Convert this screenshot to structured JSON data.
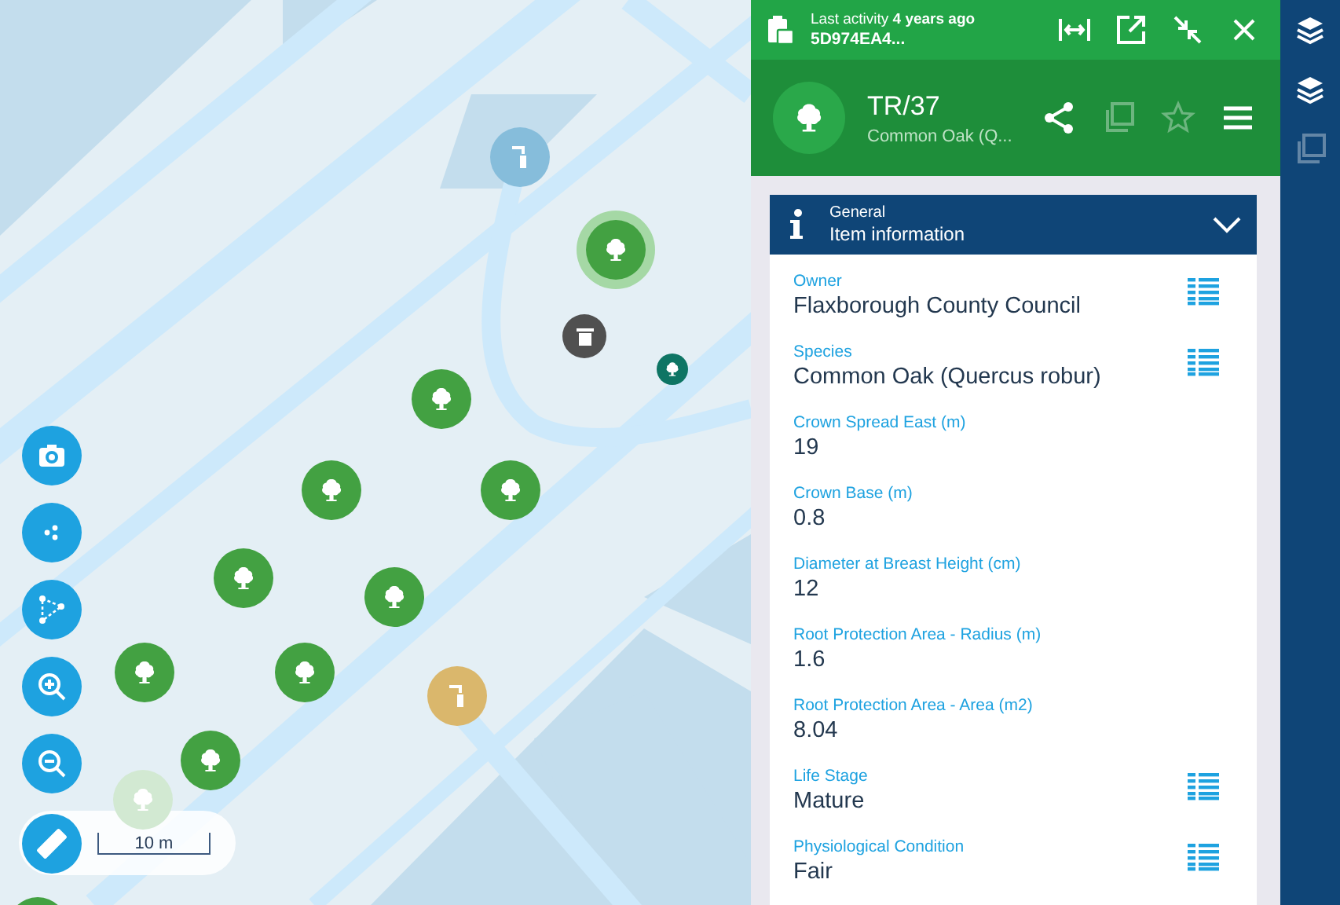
{
  "map": {
    "tools": [
      {
        "kind": "camera"
      },
      {
        "kind": "points"
      },
      {
        "kind": "polygon"
      },
      {
        "kind": "zoom-in"
      },
      {
        "kind": "zoom-out"
      }
    ],
    "scale": {
      "label": "10 m"
    },
    "markers": [
      {
        "kind": "lamp",
        "color": "#86bddb",
        "selected": false
      },
      {
        "kind": "tree",
        "color": "#43a142",
        "selected": true
      },
      {
        "kind": "bin",
        "color": "#505050",
        "selected": false
      },
      {
        "kind": "tree",
        "color": "#0e7564",
        "selected": false
      },
      {
        "kind": "tree",
        "color": "#43a142",
        "selected": false
      },
      {
        "kind": "tree",
        "color": "#43a142",
        "selected": false
      },
      {
        "kind": "tree",
        "color": "#43a142",
        "selected": false
      },
      {
        "kind": "tree",
        "color": "#43a142",
        "selected": false
      },
      {
        "kind": "tree",
        "color": "#43a142",
        "selected": false
      },
      {
        "kind": "tree",
        "color": "#43a142",
        "selected": false
      },
      {
        "kind": "tree",
        "color": "#43a142",
        "selected": false
      },
      {
        "kind": "lamp",
        "color": "#dab76c",
        "selected": false
      },
      {
        "kind": "tree",
        "color": "#43a142",
        "selected": false
      },
      {
        "kind": "tree",
        "color": "#d2e9d2",
        "selected": false
      },
      {
        "kind": "tree",
        "color": "#43a142",
        "selected": false
      }
    ]
  },
  "panel": {
    "activity": "Last activity **4 years ago**",
    "id": "5D974EA4...",
    "title": "TR/37",
    "subtitle": "Common Oak (Q...",
    "actions": [
      {
        "kind": "share",
        "disabled": false
      },
      {
        "kind": "copy",
        "disabled": true
      },
      {
        "kind": "star",
        "disabled": true
      },
      {
        "kind": "menu",
        "disabled": false
      }
    ],
    "section": {
      "overline": "General",
      "title": "Item information",
      "expanded": true
    },
    "fields": [
      {
        "label": "Owner",
        "value": "Flaxborough County Council",
        "lookup": true
      },
      {
        "label": "Species",
        "value": "Common Oak (Quercus robur)",
        "lookup": true
      },
      {
        "label": "Crown Spread East (m)",
        "value": "19",
        "lookup": false
      },
      {
        "label": "Crown Base (m)",
        "value": "0.8",
        "lookup": false
      },
      {
        "label": "Diameter at Breast Height (cm)",
        "value": "12",
        "lookup": false
      },
      {
        "label": "Root Protection Area - Radius (m)",
        "value": "1.6",
        "lookup": false
      },
      {
        "label": "Root Protection Area - Area (m2)",
        "value": "8.04",
        "lookup": false
      },
      {
        "label": "Life Stage",
        "value": "Mature",
        "lookup": true
      },
      {
        "label": "Physiological Condition",
        "value": "Fair",
        "lookup": true
      }
    ]
  },
  "rail": [
    {
      "kind": "layers",
      "disabled": false
    },
    {
      "kind": "layers",
      "disabled": false
    },
    {
      "kind": "copy",
      "disabled": true
    }
  ]
}
